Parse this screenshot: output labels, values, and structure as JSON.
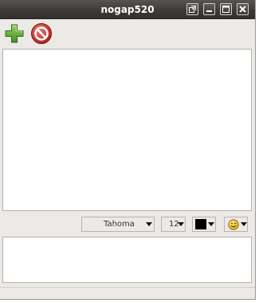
{
  "window": {
    "title": "nogap520"
  },
  "title_buttons": [
    {
      "name": "restore-icon"
    },
    {
      "name": "minimize-icon"
    },
    {
      "name": "maximize-icon"
    },
    {
      "name": "close-icon"
    }
  ],
  "toolbar": {
    "add_icon": "plus-icon",
    "block_icon": "block-icon"
  },
  "format_bar": {
    "font_value": "Tahoma",
    "size_value": "12",
    "text_color": "#000000",
    "emoticon_icon": "smiley-icon"
  },
  "colors": {
    "titlebar": "#3d3b39",
    "window_bg": "#ece9e6",
    "add_green": "#5aa832",
    "block_red": "#c8302a"
  }
}
